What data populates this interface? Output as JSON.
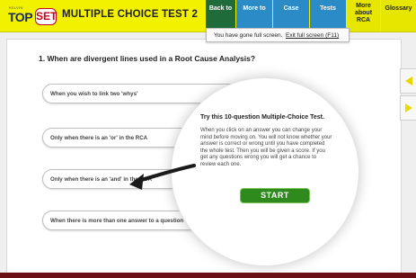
{
  "header": {
    "logo": {
      "small": "KELVIN",
      "top": "TOP",
      "set": "SET"
    },
    "title": "MULTIPLE CHOICE TEST 2",
    "nav": {
      "back": "Back to",
      "more": "More to",
      "case": "Case",
      "tests": "Tests",
      "rca_line1": "More about",
      "rca_line2": "RCA",
      "glossary": "Glossary"
    }
  },
  "fullscreen_banner": {
    "message": "You have gone full screen.",
    "exit_label": "Exit full screen (F11)"
  },
  "question": "1. When are divergent lines used in a Root Cause Analysis?",
  "answers": [
    "When you wish to link two 'whys'",
    "Only when there is an 'or' in the RCA",
    "Only when there is an 'and' in the RCA",
    "When there is more than one answer to a question"
  ],
  "intro": {
    "title": "Try this 10-question Multiple-Choice Test.",
    "body": "When you click on an answer you can change your mind before moving on. You will not know whether your answer is correct or wrong until you have completed the whole test. Then you will be given a score. If you get any questions wrong you will get a chance to review each one.",
    "start_label": "START"
  },
  "icons": [
    "prev-arrow-icon",
    "next-arrow-icon",
    "pointer-arrow-icon"
  ],
  "colors": {
    "header_bg": "#f2f200",
    "back_nav": "#1f6b3a",
    "nav_blue": "#2b8bc7",
    "start_green": "#2f8a1e",
    "side_arrow": "#e8d800",
    "bottom_bar": "#6b0f16"
  }
}
